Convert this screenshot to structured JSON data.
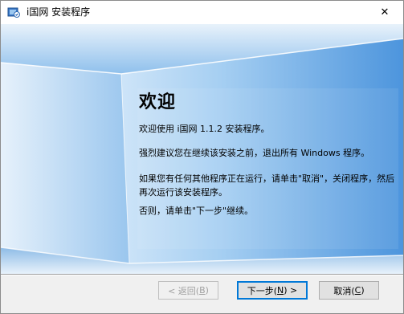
{
  "window": {
    "title": "i国网 安装程序",
    "close_symbol": "✕"
  },
  "welcome": {
    "heading": "欢迎",
    "para1": "欢迎使用 i国网 1.1.2 安装程序。",
    "para2": "强烈建议您在继续该安装之前，退出所有 Windows 程序。",
    "para3": "如果您有任何其他程序正在运行，请单击\"取消\"，关闭程序，然后再次运行该安装程序。",
    "para4": "否则，请单击\"下一步\"继续。"
  },
  "buttons": {
    "back_label": "< 返回(",
    "back_key": "B",
    "back_suffix": ")",
    "next_label": "下一步(",
    "next_key": "N",
    "next_suffix": ") >",
    "cancel_label": "取消(",
    "cancel_key": "C",
    "cancel_suffix": ")"
  },
  "colors": {
    "panel_blue": "#5a9fe0",
    "panel_light": "#c8e2f8",
    "default_button_border": "#0078d7"
  }
}
